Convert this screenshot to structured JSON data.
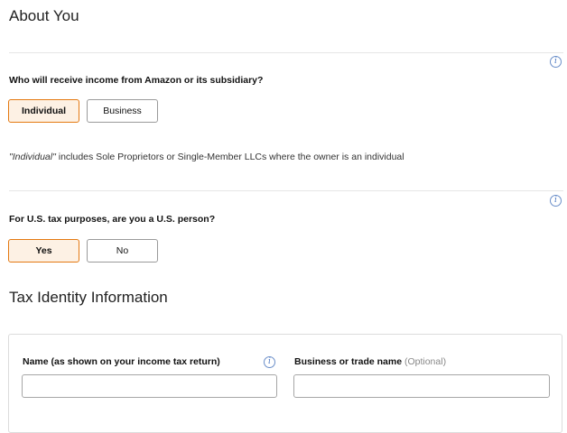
{
  "about": {
    "title": "About You",
    "q1": {
      "label": "Who will receive income from Amazon or its subsidiary?",
      "options": [
        "Individual",
        "Business"
      ],
      "selected": "Individual"
    },
    "note_italic": "\"Individual\"",
    "note_rest": " includes Sole Proprietors or Single-Member LLCs where the owner is an individual",
    "q2": {
      "label": "For U.S. tax purposes, are you a U.S. person?",
      "options": [
        "Yes",
        "No"
      ],
      "selected": "Yes"
    },
    "info_glyph": "i"
  },
  "tax": {
    "title": "Tax Identity Information",
    "name_label": "Name (as shown on your income tax return)",
    "name_value": "",
    "business_label": "Business or trade name",
    "business_optional": "(Optional)",
    "business_value": ""
  },
  "colors": {
    "accent": "#e47911",
    "selected_bg": "#fdf1e4",
    "info_blue": "#4b77c2"
  },
  "icons": [
    "info-icon"
  ]
}
